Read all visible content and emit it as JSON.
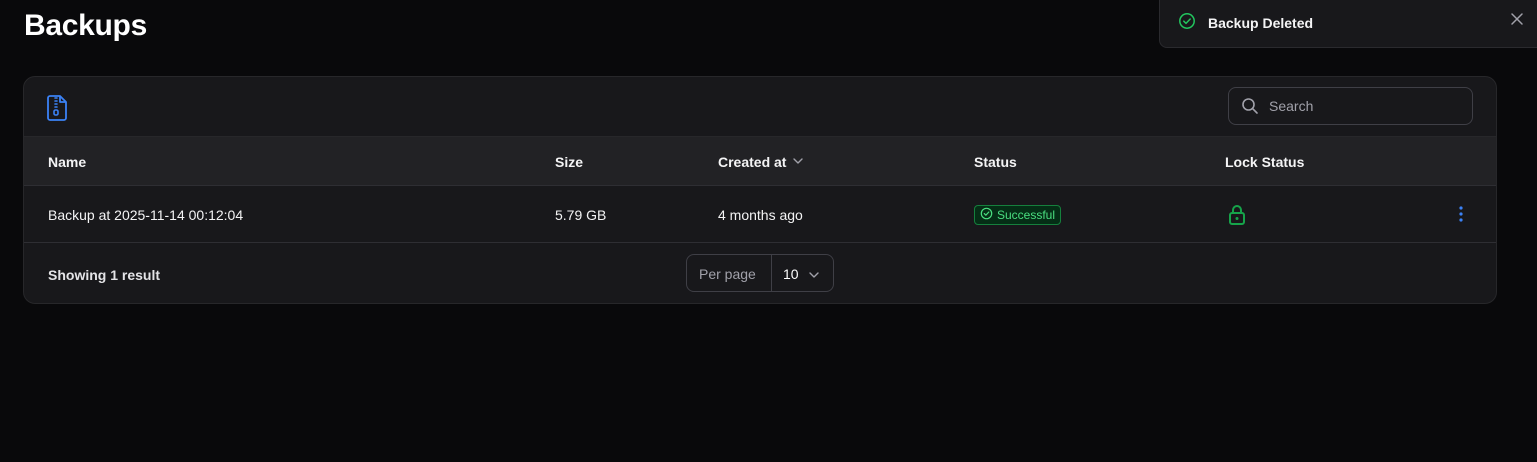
{
  "page": {
    "title": "Backups"
  },
  "toast": {
    "message": "Backup Deleted",
    "status_color": "#22c55e"
  },
  "toolbar": {
    "icon": "file-zip-icon",
    "accent_color": "#3b82f6",
    "search_placeholder": "Search"
  },
  "table": {
    "columns": [
      "Name",
      "Size",
      "Created at",
      "Status",
      "Lock Status"
    ],
    "sorted_column": "Created at",
    "rows": [
      {
        "name": "Backup at 2025-11-14 00:12:04",
        "size": "5.79 GB",
        "created_at": "4 months ago",
        "status": "Successful",
        "lock_icon": "lock-open-icon",
        "lock_color": "#16a34a"
      }
    ]
  },
  "footer": {
    "showing": "Showing 1 result",
    "per_page_label": "Per page",
    "per_page_value": "10"
  }
}
